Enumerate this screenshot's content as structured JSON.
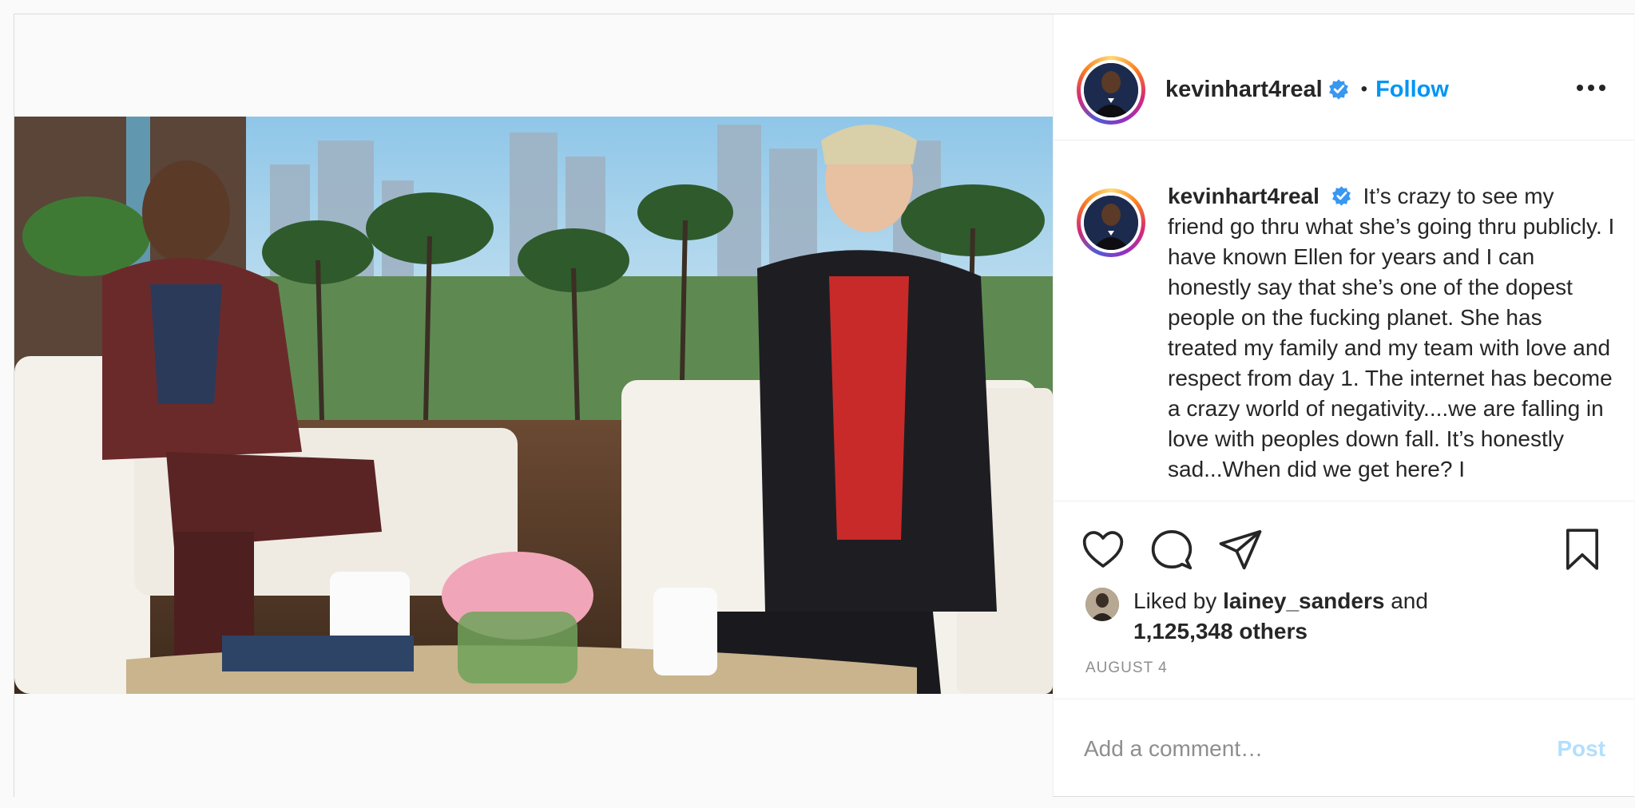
{
  "header": {
    "username": "kevinhart4real",
    "separator": "•",
    "follow_label": "Follow",
    "more_icon": "more-options-icon"
  },
  "caption": {
    "username": "kevinhart4real",
    "text": "It’s crazy to see my friend go thru what she’s going thru publicly. I have known Ellen for years and I can honestly say that she’s one of the dopest people on the fucking planet. She has treated my family and my team with love and respect from day 1. The internet has become a crazy world of negativity....we are falling in love with peoples down fall. It’s honestly sad...When did we get here? I"
  },
  "actions": {
    "like_icon": "heart-icon",
    "comment_icon": "comment-icon",
    "share_icon": "share-icon",
    "save_icon": "bookmark-icon"
  },
  "likes": {
    "prefix": "Liked by",
    "user": "lainey_sanders",
    "connector": "and",
    "count_text": "1,125,348 others"
  },
  "date": "AUGUST 4",
  "comment": {
    "placeholder": "Add a comment…",
    "post_label": "Post"
  },
  "colors": {
    "accent": "#0095f6",
    "post_disabled": "#b2dffc",
    "verified": "#3897f0"
  }
}
